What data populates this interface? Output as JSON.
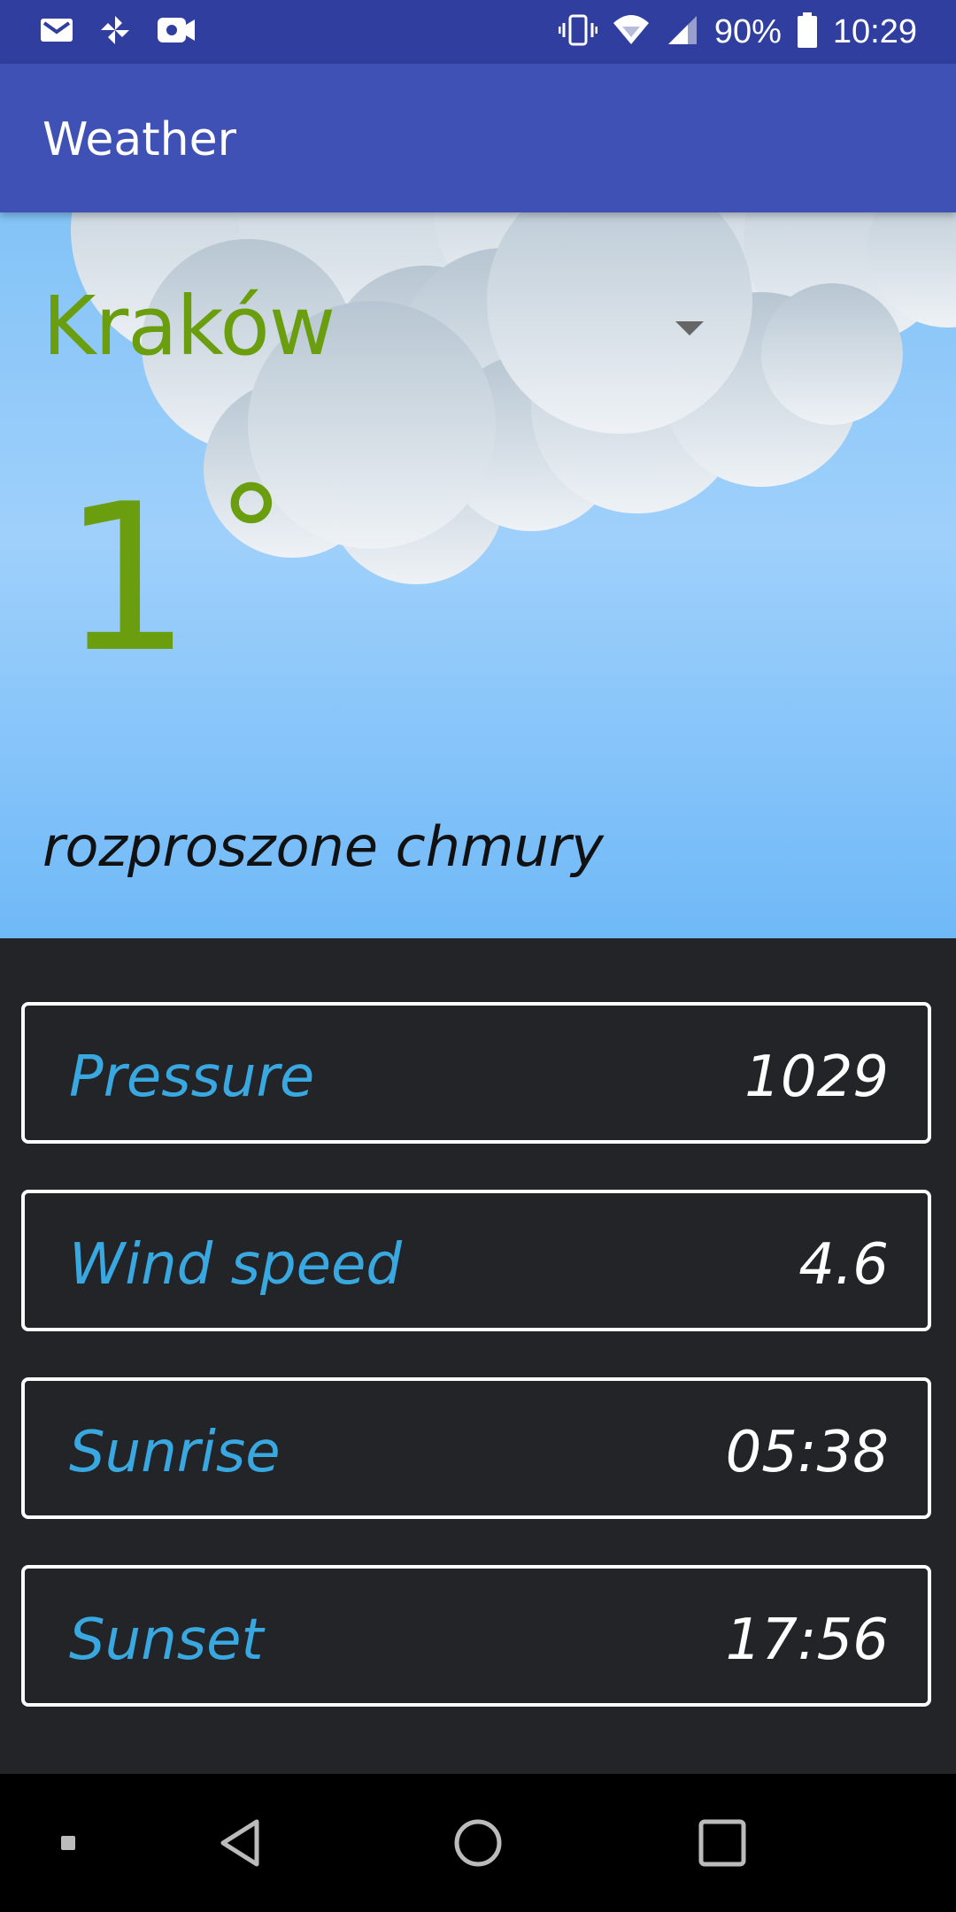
{
  "status_bar": {
    "battery": "90%",
    "time": "10:29",
    "left_icons": [
      "gmail-icon",
      "pinwheel-icon",
      "video-camera-icon"
    ],
    "right_icons": [
      "vibrate-icon",
      "wifi-icon",
      "signal-icon",
      "battery-icon"
    ]
  },
  "app_bar": {
    "title": "Weather"
  },
  "weather": {
    "city": "Kraków",
    "temperature": "1",
    "degree_symbol": "°",
    "description": "rozproszone chmury"
  },
  "stats": [
    {
      "label": "Pressure",
      "value": "1029"
    },
    {
      "label": "Wind speed",
      "value": "4.6"
    },
    {
      "label": "Sunrise",
      "value": "05:38"
    },
    {
      "label": "Sunset",
      "value": "17:56"
    }
  ],
  "colors": {
    "status_bar": "#303f9f",
    "app_bar": "#3f51b5",
    "accent_green": "#6a9e0f",
    "stat_label_blue": "#3aa8e0",
    "panel_background": "#222428"
  },
  "nav_bar": {
    "icons": [
      "small-square-icon",
      "back-icon",
      "home-icon",
      "recents-icon"
    ]
  }
}
